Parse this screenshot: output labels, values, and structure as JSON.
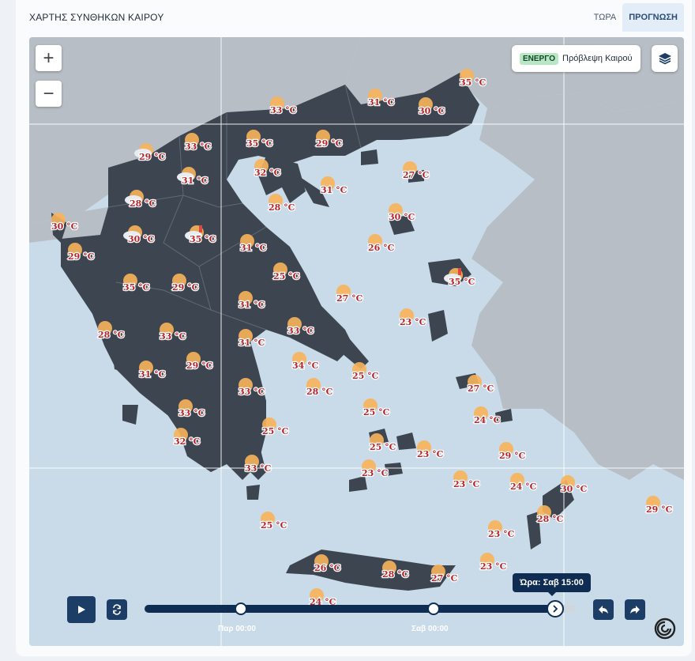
{
  "header": {
    "title": "ΧΑΡΤΗΣ ΣΥΝΘΗΚΩΝ ΚΑΙΡΟΥ",
    "tabs": [
      {
        "label": "ΤΩΡΑ",
        "active": false
      },
      {
        "label": "ΠΡΟΓΝΩΣΗ",
        "active": true
      }
    ]
  },
  "map_controls": {
    "zoom_in_label": "+",
    "zoom_out_label": "−",
    "layer_status_badge": "ΕΝΕΡΓΟ",
    "layer_name": "Πρόβλεψη Καιρού",
    "layers_icon": "layers-icon"
  },
  "weather_points": [
    {
      "temp": "35 °C",
      "icon": "sun"
    },
    {
      "temp": "33 °C",
      "icon": "sun"
    },
    {
      "temp": "31 °C",
      "icon": "sun"
    },
    {
      "temp": "30 °C",
      "icon": "sun"
    },
    {
      "temp": "33 °C",
      "icon": "sun"
    },
    {
      "temp": "35 °C",
      "icon": "sun"
    },
    {
      "temp": "29 °C",
      "icon": "sun"
    },
    {
      "temp": "29 °C",
      "icon": "cloud"
    },
    {
      "temp": "32 °C",
      "icon": "sun"
    },
    {
      "temp": "31 °C",
      "icon": "cloud"
    },
    {
      "temp": "27 °C",
      "icon": "sun"
    },
    {
      "temp": "31 °C",
      "icon": "sun"
    },
    {
      "temp": "28 °C",
      "icon": "cloud"
    },
    {
      "temp": "28 °C",
      "icon": "sun"
    },
    {
      "temp": "30 °C",
      "icon": "sun"
    },
    {
      "temp": "30 °C",
      "icon": "sun"
    },
    {
      "temp": "30 °C",
      "icon": "cloud"
    },
    {
      "temp": "35 °C",
      "icon": "storm"
    },
    {
      "temp": "29 °C",
      "icon": "sun"
    },
    {
      "temp": "31 °C",
      "icon": "sun"
    },
    {
      "temp": "26 °C",
      "icon": "sun"
    },
    {
      "temp": "25 °C",
      "icon": "sun"
    },
    {
      "temp": "35 °C",
      "icon": "storm"
    },
    {
      "temp": "35 °C",
      "icon": "sun"
    },
    {
      "temp": "29 °C",
      "icon": "sun"
    },
    {
      "temp": "27 °C",
      "icon": "sun"
    },
    {
      "temp": "31 °C",
      "icon": "sun"
    },
    {
      "temp": "28 °C",
      "icon": "sun"
    },
    {
      "temp": "33 °C",
      "icon": "sun"
    },
    {
      "temp": "33 °C",
      "icon": "sun"
    },
    {
      "temp": "23 °C",
      "icon": "sun"
    },
    {
      "temp": "31 °C",
      "icon": "sun"
    },
    {
      "temp": "34 °C",
      "icon": "sun"
    },
    {
      "temp": "29 °C",
      "icon": "sun"
    },
    {
      "temp": "31 °C",
      "icon": "sun"
    },
    {
      "temp": "25 °C",
      "icon": "sun"
    },
    {
      "temp": "33 °C",
      "icon": "sun"
    },
    {
      "temp": "28 °C",
      "icon": "sun"
    },
    {
      "temp": "27 °C",
      "icon": "sun"
    },
    {
      "temp": "33 °C",
      "icon": "sun"
    },
    {
      "temp": "25 °C",
      "icon": "sun"
    },
    {
      "temp": "24 °C",
      "icon": "sun"
    },
    {
      "temp": "25 °C",
      "icon": "sun"
    },
    {
      "temp": "32 °C",
      "icon": "sun"
    },
    {
      "temp": "25 °C",
      "icon": "sun"
    },
    {
      "temp": "23 °C",
      "icon": "sun"
    },
    {
      "temp": "29 °C",
      "icon": "sun"
    },
    {
      "temp": "33 °C",
      "icon": "sun"
    },
    {
      "temp": "23 °C",
      "icon": "sun"
    },
    {
      "temp": "23 °C",
      "icon": "sun"
    },
    {
      "temp": "24 °C",
      "icon": "sun"
    },
    {
      "temp": "30 °C",
      "icon": "sun"
    },
    {
      "temp": "28 °C",
      "icon": "sun"
    },
    {
      "temp": "29 °C",
      "icon": "sun"
    },
    {
      "temp": "25 °C",
      "icon": "sun"
    },
    {
      "temp": "23 °C",
      "icon": "sun"
    },
    {
      "temp": "23 °C",
      "icon": "sun"
    },
    {
      "temp": "26 °C",
      "icon": "sun"
    },
    {
      "temp": "28 °C",
      "icon": "sun"
    },
    {
      "temp": "27 °C",
      "icon": "sun"
    },
    {
      "temp": "24 °C",
      "icon": "sun"
    }
  ],
  "timeline": {
    "tooltip": "Ώρα: Σαβ 15:00",
    "ticks": [
      "Παρ 00:00",
      "Σαβ 00:00"
    ],
    "progress": 0.95,
    "play_icon": "play-icon",
    "loop_icon": "loop-icon",
    "prev_icon": "step-back-icon",
    "next_icon": "step-forward-icon",
    "next_step_icon": "chevron-right-icon"
  },
  "logo_icon": "brand-logo-icon"
}
